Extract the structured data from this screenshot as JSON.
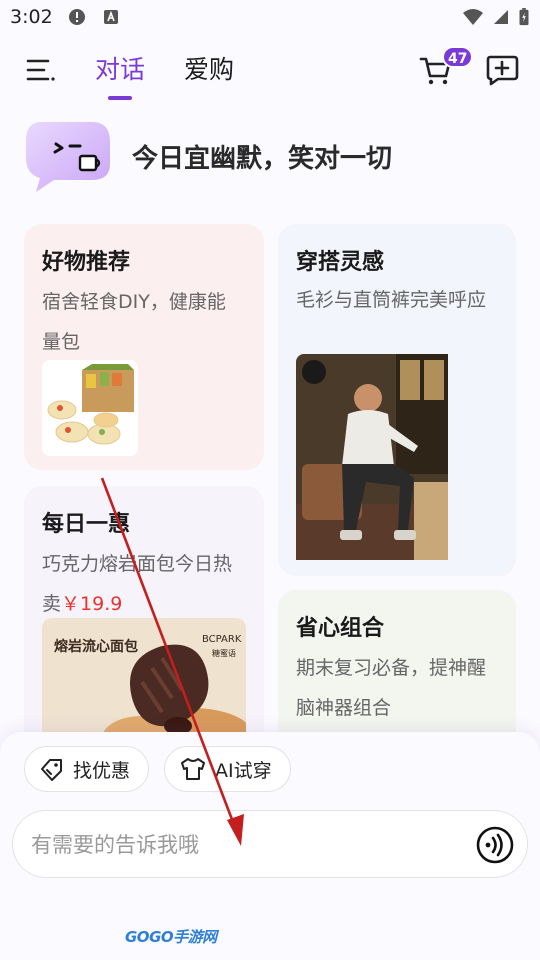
{
  "status_bar": {
    "time": "3:02"
  },
  "header": {
    "tabs": [
      {
        "label": "对话",
        "active": true
      },
      {
        "label": "爱购",
        "active": false
      }
    ],
    "cart_badge": "47"
  },
  "greeting": {
    "text": "今日宜幽默，笑对一切"
  },
  "cards": {
    "good_picks": {
      "title": "好物推荐",
      "subtitle_line1": "宿舍轻食DIY，健康能",
      "subtitle_line2": "量包"
    },
    "daily_deal": {
      "title": "每日一惠",
      "subtitle_line1": "巧克力熔岩面包今日热",
      "subtitle_line2_prefix": "卖",
      "price": "￥19.9",
      "image_title": "熔岩流心面包",
      "image_brand": "BCPARK",
      "image_brand_cn": "糖蜜语"
    },
    "outfit": {
      "title": "穿搭灵感",
      "subtitle_line1": "毛衫与直筒裤完美呼应"
    },
    "combo": {
      "title": "省心组合",
      "subtitle_line1": "期末复习必备，提神醒",
      "subtitle_line2": "脑神器组合"
    }
  },
  "chips": [
    {
      "label": "找优惠"
    },
    {
      "label": "AI试穿"
    }
  ],
  "input": {
    "placeholder": "有需要的告诉我哦"
  },
  "watermark": {
    "text": "GOGO手游网"
  },
  "colors": {
    "accent": "#7b3ad8",
    "price": "#e8332f",
    "pink_card": "#fcefef",
    "lavender_card": "#f6f3fb",
    "blue_card": "#f2f5fb",
    "green_card": "#f3f5ef"
  }
}
